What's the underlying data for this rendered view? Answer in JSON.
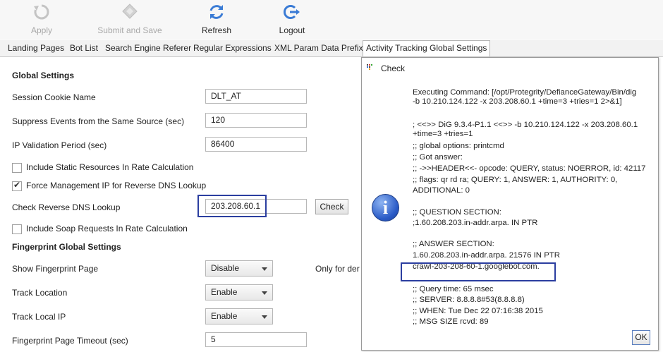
{
  "toolbar": {
    "apply": "Apply",
    "submit": "Submit and Save",
    "refresh": "Refresh",
    "logout": "Logout",
    "apply_icon": "undo-arrow-icon",
    "submit_icon": "diamond-save-icon",
    "refresh_icon": "refresh-icon",
    "logout_icon": "logout-icon"
  },
  "tabs": [
    {
      "label": "Landing Pages"
    },
    {
      "label": "Bot List"
    },
    {
      "label": "Search Engine Referer"
    },
    {
      "label": "Regular Expressions"
    },
    {
      "label": "XML Param Data Prefix"
    },
    {
      "label": "Activity Tracking Global Settings"
    }
  ],
  "form": {
    "global_title": "Global Settings",
    "session_cookie_label": "Session Cookie Name",
    "session_cookie_value": "DLT_AT",
    "suppress_label": "Suppress Events from  the Same Source (sec)",
    "suppress_value": "120",
    "ip_validation_label": "IP Validation Period (sec)",
    "ip_validation_value": "86400",
    "static_resources_label": "Include Static Resources In Rate Calculation",
    "static_resources_checked": false,
    "force_mgmt_label": "Force Management IP for Reverse DNS Lookup",
    "force_mgmt_checked": true,
    "check_dns_label": "Check Reverse DNS Lookup",
    "check_dns_value": "203.208.60.1",
    "check_button": "Check",
    "soap_label": "Include Soap Requests In Rate Calculation",
    "soap_checked": false,
    "fingerprint_title": "Fingerprint Global Settings",
    "show_fp_label": "Show Fingerprint Page",
    "show_fp_value": "Disable",
    "only_for_text": "Only for der",
    "track_location_label": "Track Location",
    "track_location_value": "Enable",
    "track_local_ip_label": "Track Local IP",
    "track_local_ip_value": "Enable",
    "fp_timeout_label": "Fingerprint Page Timeout (sec)",
    "fp_timeout_value": "5"
  },
  "dialog": {
    "title": "Check",
    "icon": "info-icon",
    "ok": "OK",
    "lines": [
      "Executing Command: [/opt/Protegrity/DefianceGateway/Bin/dig",
      "-b 10.210.124.122 -x 203.208.60.1 +time=3 +tries=1 2>&1]",
      "",
      "; <<>> DiG 9.3.4-P1.1 <<>> -b 10.210.124.122 -x 203.208.60.1",
      "+time=3 +tries=1",
      ";; global options:  printcmd",
      ";; Got answer:",
      ";; ->>HEADER<<- opcode: QUERY, status: NOERROR, id: 42117",
      ";; flags: qr rd ra; QUERY: 1, ANSWER: 1, AUTHORITY: 0,",
      "ADDITIONAL: 0",
      "",
      ";; QUESTION SECTION:",
      ";1.60.208.203.in-addr.arpa.       IN      PTR",
      "",
      ";; ANSWER SECTION:",
      "1.60.208.203.in-addr.arpa. 21576 IN       PTR",
      "crawl-203-208-60-1.googlebot.com.",
      "",
      ";; Query time: 65 msec",
      ";; SERVER: 8.8.8.8#53(8.8.8.8)",
      ";; WHEN: Tue Dec 22 07:16:38 2015",
      ";; MSG SIZE  rcvd: 89"
    ]
  },
  "colors": {
    "highlight": "#2b3ea0",
    "info_icon": "#2a5bc7"
  }
}
